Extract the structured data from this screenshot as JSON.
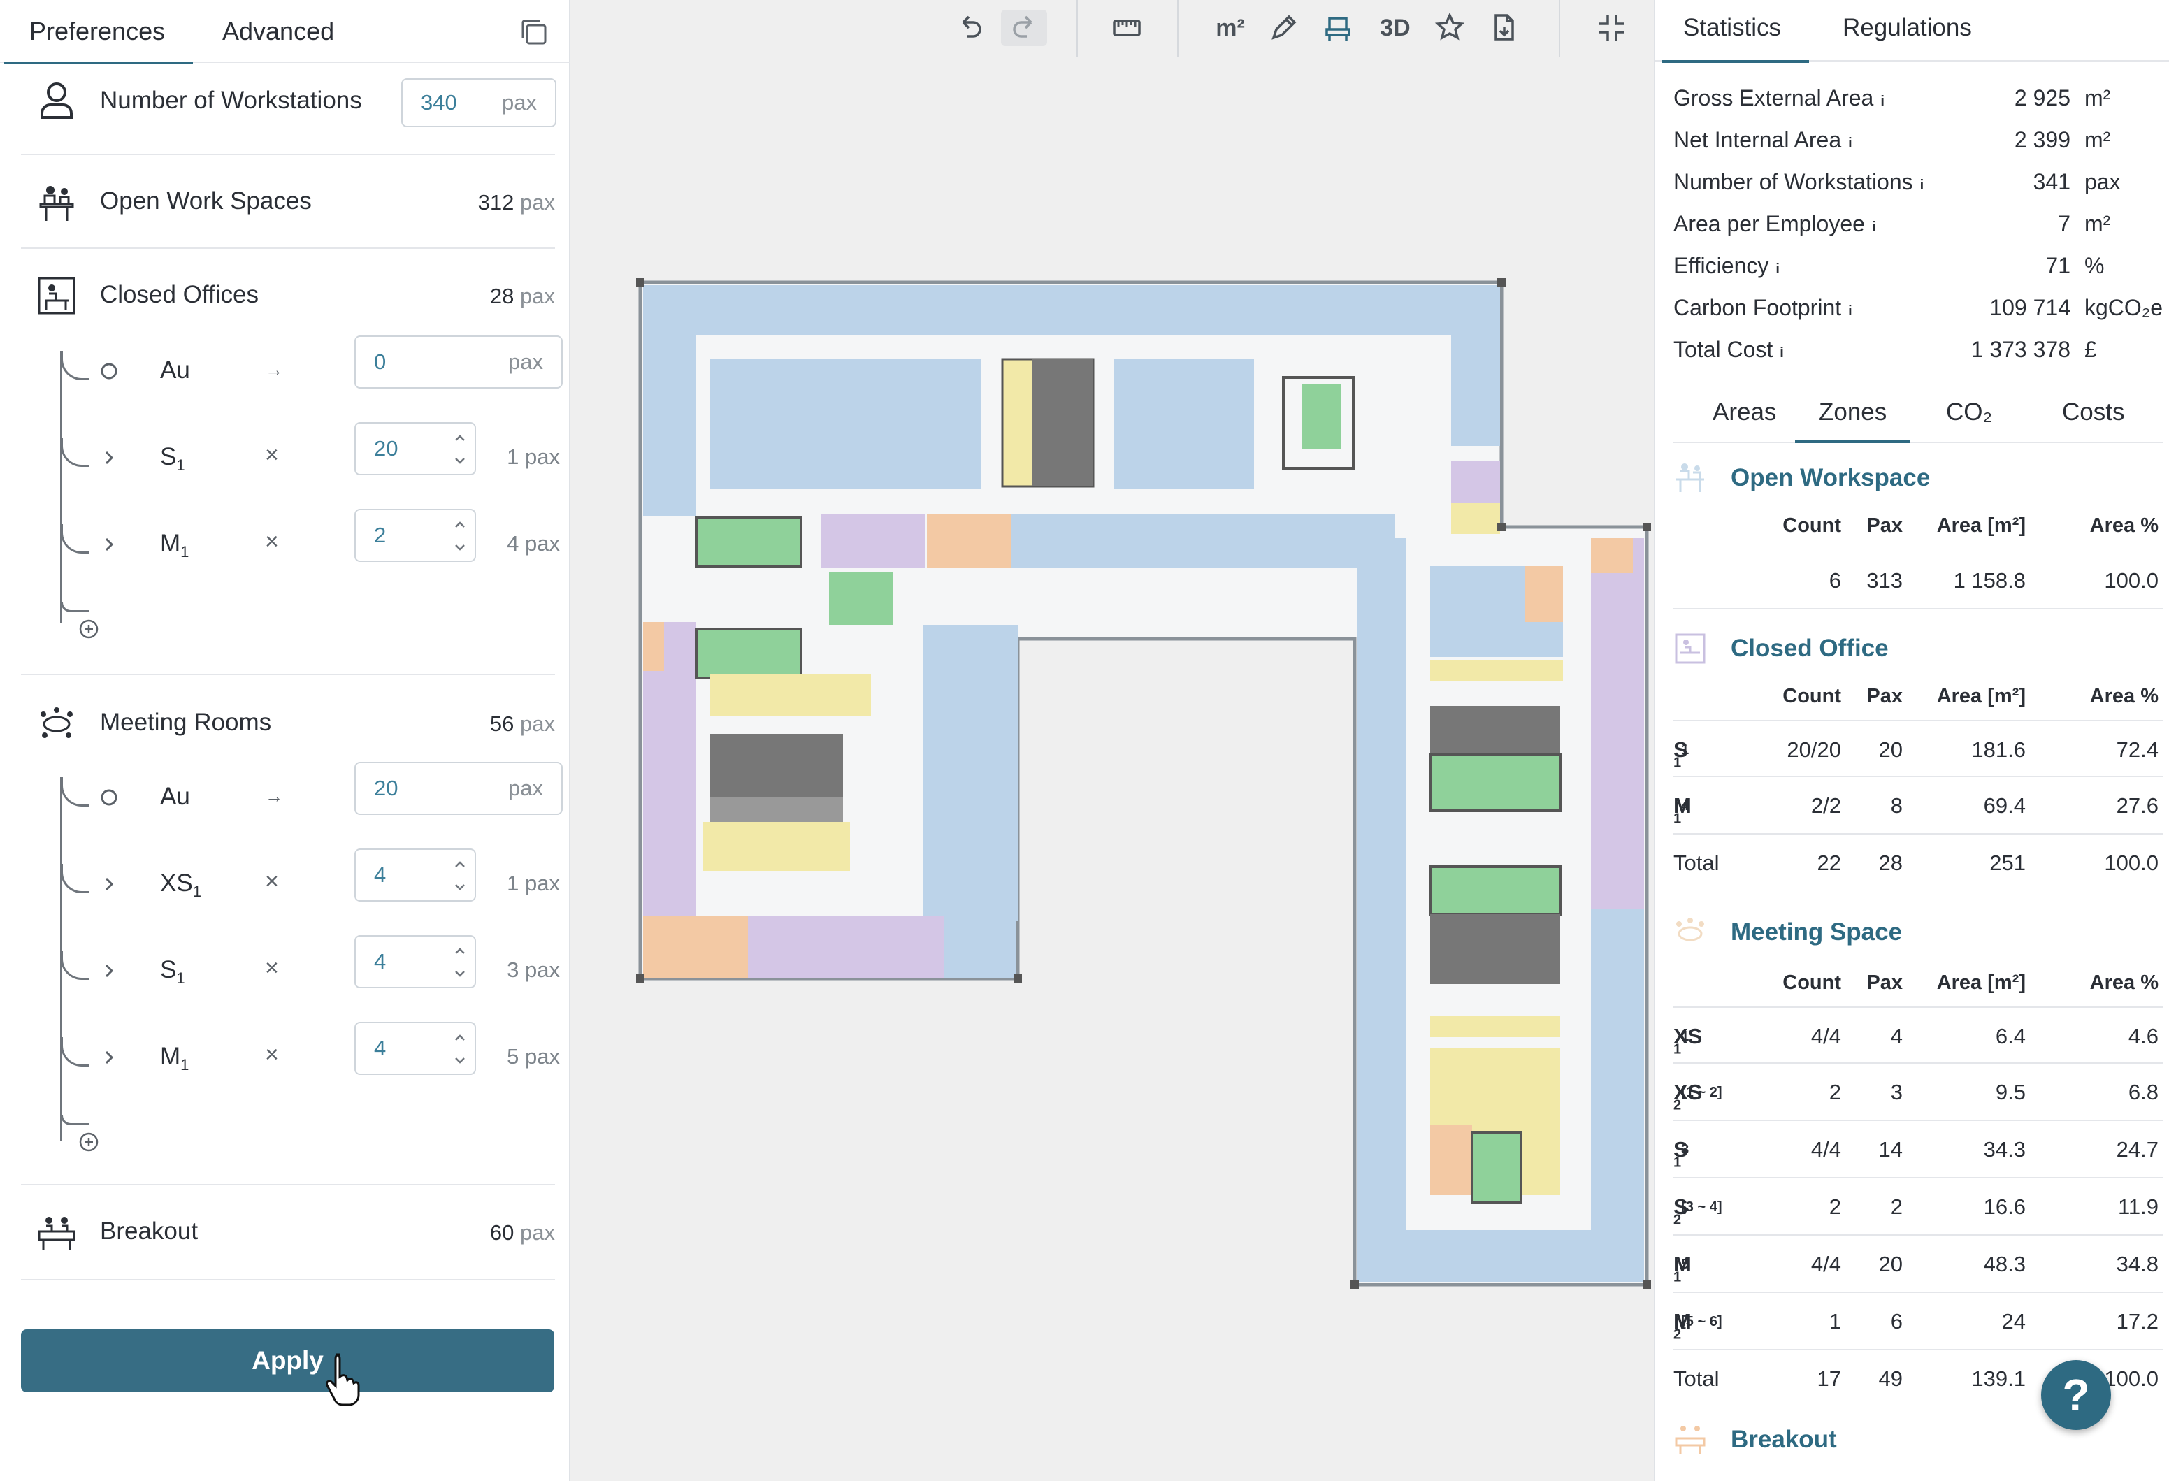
{
  "left_panel": {
    "tabs": [
      "Preferences",
      "Advanced"
    ],
    "workstations": {
      "label": "Number of Workstations",
      "value": "340",
      "unit": "pax"
    },
    "open_work_spaces": {
      "label": "Open Work Spaces",
      "value": "312",
      "unit": "pax"
    },
    "closed_offices": {
      "label": "Closed Offices",
      "value": "28",
      "unit": "pax",
      "items": [
        {
          "name": "Au",
          "sub": "",
          "op": "→",
          "value": "0",
          "unit": "pax",
          "pax": ""
        },
        {
          "name": "S",
          "sub": "1",
          "op": "×",
          "value": "20",
          "unit": "",
          "pax": "1 pax"
        },
        {
          "name": "M",
          "sub": "1",
          "op": "×",
          "value": "2",
          "unit": "",
          "pax": "4 pax"
        }
      ]
    },
    "meeting_rooms": {
      "label": "Meeting Rooms",
      "value": "56",
      "unit": "pax",
      "items": [
        {
          "name": "Au",
          "sub": "",
          "op": "→",
          "value": "20",
          "unit": "pax",
          "pax": ""
        },
        {
          "name": "XS",
          "sub": "1",
          "op": "×",
          "value": "4",
          "unit": "",
          "pax": "1 pax"
        },
        {
          "name": "S",
          "sub": "1",
          "op": "×",
          "value": "4",
          "unit": "",
          "pax": "3 pax"
        },
        {
          "name": "M",
          "sub": "1",
          "op": "×",
          "value": "4",
          "unit": "",
          "pax": "5 pax"
        }
      ]
    },
    "breakout": {
      "label": "Breakout",
      "value": "60",
      "unit": "pax"
    },
    "apply_label": "Apply"
  },
  "toolbar": {
    "undo_icon": "undo-icon",
    "redo_icon": "redo-icon",
    "measure_icon": "ruler-icon",
    "area_label": "m²",
    "view3d_label": "3D"
  },
  "right_panel": {
    "tabs": [
      "Statistics",
      "Regulations"
    ],
    "stats": [
      {
        "label": "Gross External Area",
        "value": "2 925",
        "unit": "m²"
      },
      {
        "label": "Net Internal Area",
        "value": "2 399",
        "unit": "m²"
      },
      {
        "label": "Number of Workstations",
        "value": "341",
        "unit": "pax"
      },
      {
        "label": "Area per Employee",
        "value": "7",
        "unit": "m²"
      },
      {
        "label": "Efficiency",
        "value": "71",
        "unit": "%"
      },
      {
        "label": "Carbon Footprint",
        "value": "109 714",
        "unit": "kgCO₂e"
      },
      {
        "label": "Total Cost",
        "value": "1 373 378",
        "unit": "£"
      }
    ],
    "zone_tabs": [
      "Areas",
      "Zones",
      "CO₂",
      "Costs"
    ],
    "columns": [
      "Count",
      "Pax",
      "Area [m²]",
      "Area %"
    ],
    "zones": {
      "open_workspace": {
        "title": "Open Workspace",
        "rows": [
          {
            "name": "",
            "sub": "",
            "sup": "",
            "count": "6",
            "pax": "313",
            "area": "1 158.8",
            "pct": "100.0"
          }
        ]
      },
      "closed_office": {
        "title": "Closed Office",
        "rows": [
          {
            "name": "S",
            "sub": "1",
            "sup": "1",
            "count": "20/20",
            "pax": "20",
            "area": "181.6",
            "pct": "72.4"
          },
          {
            "name": "M",
            "sub": "1",
            "sup": "4",
            "count": "2/2",
            "pax": "8",
            "area": "69.4",
            "pct": "27.6"
          },
          {
            "name": "Total",
            "sub": "",
            "sup": "",
            "count": "22",
            "pax": "28",
            "area": "251",
            "pct": "100.0"
          }
        ]
      },
      "meeting_space": {
        "title": "Meeting Space",
        "rows": [
          {
            "name": "XS",
            "sub": "1",
            "sup": "1",
            "count": "4/4",
            "pax": "4",
            "area": "6.4",
            "pct": "4.6"
          },
          {
            "name": "XS",
            "sub": "2",
            "sup": "[1 ~ 2]",
            "count": "2",
            "pax": "3",
            "area": "9.5",
            "pct": "6.8"
          },
          {
            "name": "S",
            "sub": "1",
            "sup": "3",
            "count": "4/4",
            "pax": "14",
            "area": "34.3",
            "pct": "24.7"
          },
          {
            "name": "S",
            "sub": "2",
            "sup": "[3 ~ 4]",
            "count": "2",
            "pax": "2",
            "area": "16.6",
            "pct": "11.9"
          },
          {
            "name": "M",
            "sub": "1",
            "sup": "5",
            "count": "4/4",
            "pax": "20",
            "area": "48.3",
            "pct": "34.8"
          },
          {
            "name": "M",
            "sub": "2",
            "sup": "[5 ~ 6]",
            "count": "1",
            "pax": "6",
            "area": "24",
            "pct": "17.2"
          },
          {
            "name": "Total",
            "sub": "",
            "sup": "",
            "count": "17",
            "pax": "49",
            "area": "139.1",
            "pct": "100.0"
          }
        ]
      },
      "breakout": {
        "title": "Breakout"
      }
    },
    "help_label": "?"
  },
  "colors": {
    "accent": "#2e6a82",
    "apply": "#376d84",
    "workspace": "#bcd3e9",
    "meeting": "#d4c6e6",
    "breakout": "#f3c9a4",
    "stairs": "#8fd19a",
    "yellow": "#f2e9a8"
  }
}
